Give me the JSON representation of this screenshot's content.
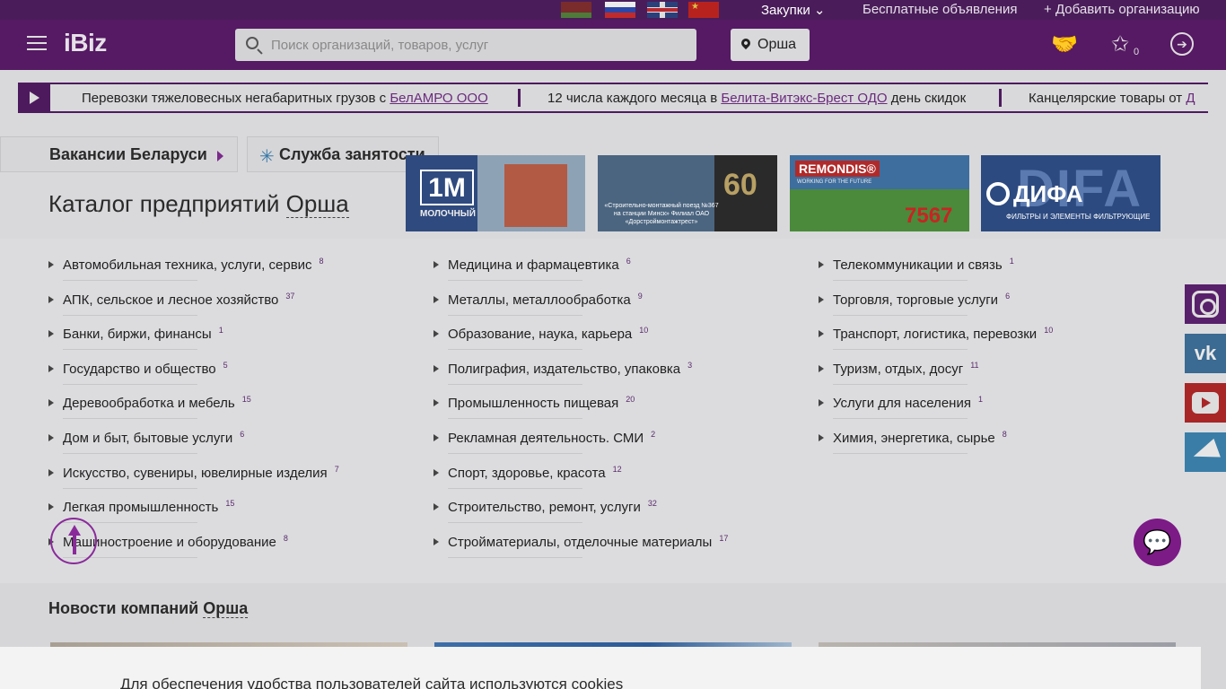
{
  "topbar": {
    "flags": [
      "by",
      "ru",
      "gb",
      "cn"
    ],
    "zakupki": "Закупки",
    "free_ads": "Бесплатные объявления",
    "add_org": "Добавить организацию"
  },
  "header": {
    "logo": "iBiz",
    "search_placeholder": "Поиск организаций, товаров, услуг",
    "city": "Орша",
    "favorites_count": "0",
    "accent": "#551a63"
  },
  "ticker": {
    "items": [
      {
        "prefix": "Перевозки тяжеловесных негабаритных грузов с ",
        "link": "БелАМРО ООО",
        "suffix": ""
      },
      {
        "prefix": "12 числа каждого месяца в ",
        "link": "Белита-Витэкс-Брест ОДО",
        "suffix": " день скидок"
      },
      {
        "prefix": "Канцелярские товары от ",
        "link": "Д",
        "suffix": ""
      }
    ]
  },
  "tabs": {
    "vacancies": "Вакансии Беларуси",
    "employment": "Служба занятости"
  },
  "catalog": {
    "title_prefix": "Каталог предприятий ",
    "city": "Орша"
  },
  "banners": [
    {
      "logo": "1M",
      "sub": "МОЛОЧНЫЙ"
    },
    {
      "text": "«Строительно-монтажный поезд №367 на станции Минск» Филиал ОАО «Дорстроймонтажтрест»",
      "num": "60"
    },
    {
      "name": "REMONDIS®",
      "sub": "WORKING FOR THE FUTURE",
      "num": "7567"
    },
    {
      "bg": "DIFA",
      "name": "ДИФА",
      "sub": "ФИЛЬТРЫ И ЭЛЕМЕНТЫ ФИЛЬТРУЮЩИЕ"
    }
  ],
  "categories": {
    "col1": [
      {
        "label": "Автомобильная техника, услуги, сервис",
        "count": "8"
      },
      {
        "label": "АПК, сельское и лесное хозяйство",
        "count": "37"
      },
      {
        "label": "Банки, биржи, финансы",
        "count": "1"
      },
      {
        "label": "Государство и общество",
        "count": "5"
      },
      {
        "label": "Деревообработка и мебель",
        "count": "15"
      },
      {
        "label": "Дом и быт, бытовые услуги",
        "count": "6"
      },
      {
        "label": "Искусство, сувениры, ювелирные изделия",
        "count": "7"
      },
      {
        "label": "Легкая промышленность",
        "count": "15"
      },
      {
        "label": "Машиностроение и оборудование",
        "count": "8"
      }
    ],
    "col2": [
      {
        "label": "Медицина и фармацевтика",
        "count": "6"
      },
      {
        "label": "Металлы, металлообработка",
        "count": "9"
      },
      {
        "label": "Образование, наука, карьера",
        "count": "10"
      },
      {
        "label": "Полиграфия, издательство, упаковка",
        "count": "3"
      },
      {
        "label": "Промышленность пищевая",
        "count": "20"
      },
      {
        "label": "Рекламная деятельность. СМИ",
        "count": "2"
      },
      {
        "label": "Спорт, здоровье, красота",
        "count": "12"
      },
      {
        "label": "Строительство, ремонт, услуги",
        "count": "32"
      },
      {
        "label": "Стройматериалы, отделочные материалы",
        "count": "17"
      }
    ],
    "col3": [
      {
        "label": "Телекоммуникации и связь",
        "count": "1"
      },
      {
        "label": "Торговля, торговые услуги",
        "count": "6"
      },
      {
        "label": "Транспорт, логистика, перевозки",
        "count": "10"
      },
      {
        "label": "Туризм, отдых, досуг",
        "count": "11"
      },
      {
        "label": "Услуги для населения",
        "count": "1"
      },
      {
        "label": "Химия, энергетика, сырье",
        "count": "8"
      }
    ]
  },
  "social": {
    "vk": "vk"
  },
  "news": {
    "title_prefix": "Новости компаний ",
    "city": "Орша"
  },
  "cookie": {
    "text": "Для обеспечения удобства пользователей сайта используются cookies"
  }
}
